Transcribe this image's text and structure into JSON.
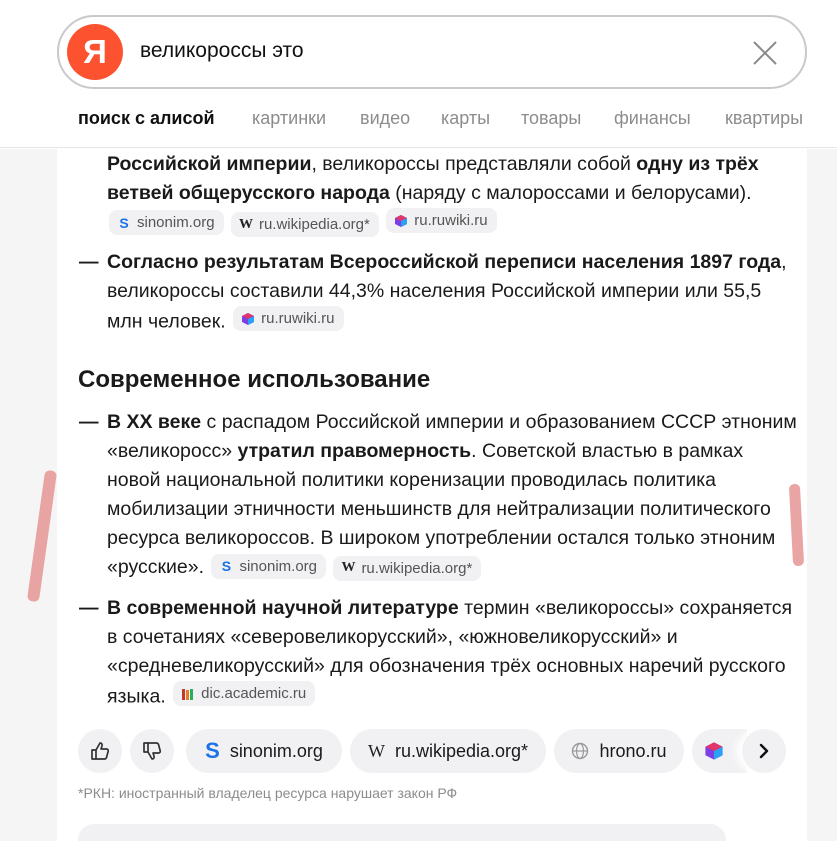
{
  "search": {
    "logo_letter": "Я",
    "query": "великороссы это"
  },
  "tabs": [
    {
      "label": "поиск с алисой",
      "active": true
    },
    {
      "label": "картинки"
    },
    {
      "label": "видео"
    },
    {
      "label": "карты"
    },
    {
      "label": "товары"
    },
    {
      "label": "финансы"
    },
    {
      "label": "квартиры"
    }
  ],
  "content": {
    "p1": {
      "t1": "Российской империи",
      "t2": ", великороссы представляли собой ",
      "t3": "одну из трёх ветвей общерусского народа",
      "t4": " (наряду с малороссами и белорусами).",
      "sources": [
        {
          "label": "sinonim.org",
          "icon": "sinonim-icon"
        },
        {
          "label": "ru.wikipedia.org*",
          "icon": "wikipedia-icon"
        },
        {
          "label": "ru.ruwiki.ru",
          "icon": "ruwiki-icon"
        }
      ]
    },
    "p2": {
      "dash": "—",
      "t1": "Согласно результатам Всероссийской переписи населения 1897 года",
      "t2": ", великороссы составили 44,3% населения Российской империи или 55,5 млн человек.",
      "sources": [
        {
          "label": "ru.ruwiki.ru",
          "icon": "ruwiki-icon"
        }
      ]
    },
    "section_title": "Современное использование",
    "p3": {
      "dash": "—",
      "t1": "В XX веке",
      "t2": " с распадом Российской империи и образованием СССР этноним «великоросс» ",
      "t3": "утратил правомерность",
      "t4": ". Советской властью в рамках новой национальной политики коренизации проводилась политика мобилизации этничности меньшинств для нейтрализации политического ресурса великороссов. В широком употреблении остался только этноним «русские».",
      "sources": [
        {
          "label": "sinonim.org",
          "icon": "sinonim-icon"
        },
        {
          "label": "ru.wikipedia.org*",
          "icon": "wikipedia-icon"
        }
      ]
    },
    "p4": {
      "dash": "—",
      "t1": "В современной научной литературе",
      "t2": " термин «великороссы» сохраняется в сочетаниях «северовеликорусский», «южновеликорусский» и «средневеликорусский» для обозначения трёх основных наречий русского языка.",
      "sources": [
        {
          "label": "dic.academic.ru",
          "icon": "academic-icon"
        }
      ]
    }
  },
  "actions": {
    "chips": [
      {
        "label": "sinonim.org",
        "icon": "sinonim-icon"
      },
      {
        "label": "ru.wikipedia.org*",
        "icon": "wikipedia-icon"
      },
      {
        "label": "hrono.ru",
        "icon": "globe-icon"
      }
    ]
  },
  "footnote": "*РКН: иностранный владелец ресурса нарушает закон РФ",
  "colors": {
    "brand_red": "#fc5230",
    "chip_bg": "#f1f1f3",
    "sinonim_blue": "#1a73e8",
    "marker_pink": "#e79a9a"
  }
}
